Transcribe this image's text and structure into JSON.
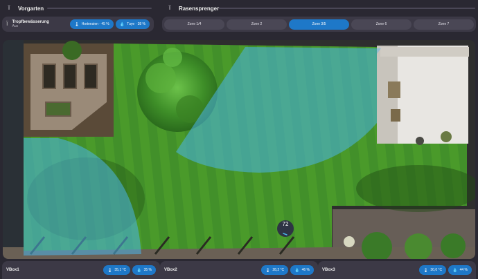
{
  "sections": {
    "vorgarten": {
      "title": "Vorgarten",
      "icon": "tap-icon"
    },
    "rasensprenger": {
      "title": "Rasensprenger",
      "icon": "tap-icon"
    }
  },
  "tropf": {
    "name": "Tropfbewässerung",
    "state": "Aus",
    "chips": [
      {
        "icon": "thermometer-icon",
        "label": "Hortensien · 45 %"
      },
      {
        "icon": "drop-icon",
        "label": "Tuye · 38 %"
      }
    ]
  },
  "zones": [
    {
      "label": "Zone 1/4",
      "active": false
    },
    {
      "label": "Zone 2",
      "active": false
    },
    {
      "label": "Zone 3/5",
      "active": true
    },
    {
      "label": "Zone 6",
      "active": false
    },
    {
      "label": "Zone 7",
      "active": false
    }
  ],
  "map": {
    "badge": "72"
  },
  "vboxes": [
    {
      "name": "VBox1",
      "temp": "35,1 °C",
      "hum": "35 %"
    },
    {
      "name": "VBox2",
      "temp": "28,2 °C",
      "hum": "46 %"
    },
    {
      "name": "VBox3",
      "temp": "30,0 °C",
      "hum": "44 %"
    }
  ],
  "colors": {
    "accent": "#1e78c8",
    "card": "#3c3946",
    "background": "#2a2832",
    "spray": "#4ab4ea"
  }
}
